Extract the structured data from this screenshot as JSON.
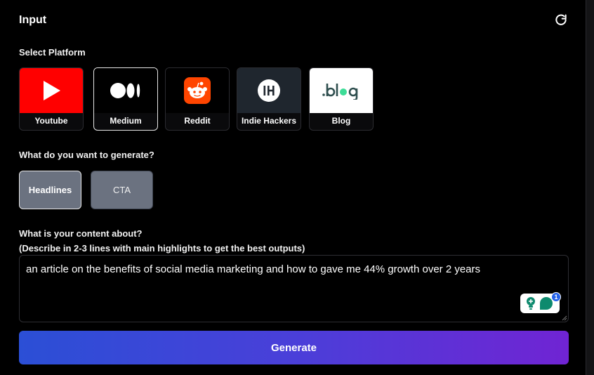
{
  "panel": {
    "title": "Input"
  },
  "platform_section": {
    "label": "Select Platform",
    "selected": "Medium",
    "items": [
      {
        "label": "Youtube",
        "icon": "youtube-play-icon",
        "color": "#ff0000"
      },
      {
        "label": "Medium",
        "icon": "medium-logo-icon",
        "color": "#000000"
      },
      {
        "label": "Reddit",
        "icon": "reddit-logo-icon",
        "color": "#ff4500"
      },
      {
        "label": "Indie Hackers",
        "icon": "indie-hackers-logo-icon",
        "color": "#1f262e"
      },
      {
        "label": "Blog",
        "icon": "blog-logo-icon",
        "color": "#ffffff"
      }
    ]
  },
  "generate_section": {
    "label": "What do you want to generate?",
    "selected": "Headlines",
    "options": [
      "Headlines",
      "CTA"
    ]
  },
  "content_section": {
    "label": "What is your content about?",
    "hint": "(Describe in 2-3 lines with main highlights to get the best outputs)",
    "value": "an article on the benefits of social media marketing and how to gave me 44% growth over 2 years"
  },
  "assistant_widget": {
    "badge_count": "1",
    "accent": "#0e8a6e"
  },
  "actions": {
    "generate_label": "Generate"
  },
  "colors": {
    "gradient_start": "#2b4fd6",
    "gradient_end": "#7024d3",
    "option_bg": "#6b7280"
  }
}
